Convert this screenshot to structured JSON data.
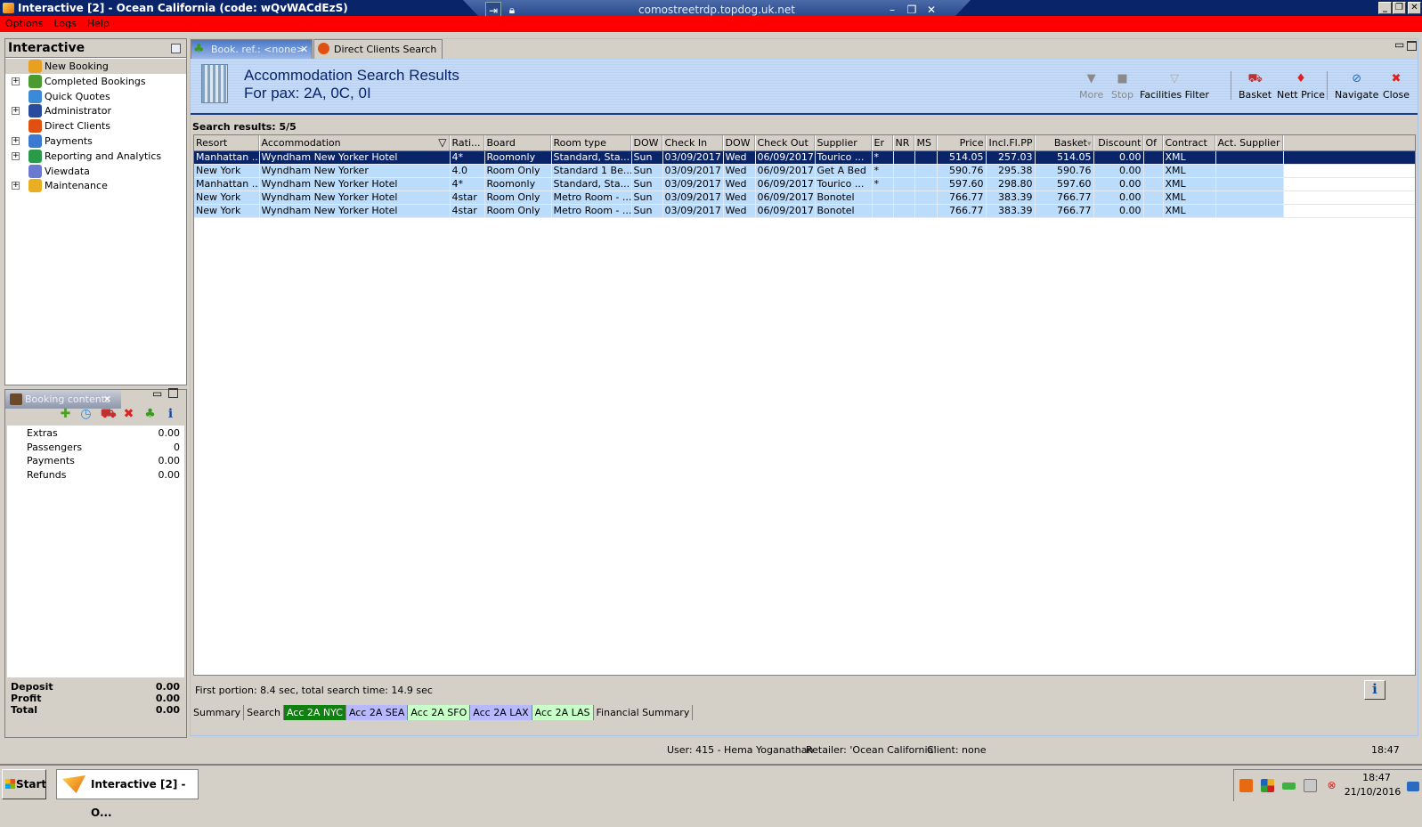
{
  "window": {
    "title": "Interactive [2] - Ocean California (code: wQvWACdEzS)",
    "rdp_host": "comostreetrdp.topdog.uk.net"
  },
  "menu": [
    "Options",
    "Logs",
    "Help"
  ],
  "sidebar": {
    "title": "Interactive",
    "items": [
      {
        "label": "New Booking",
        "expandable": false,
        "icon": "palm-tree-icon",
        "color": "#e8a020"
      },
      {
        "label": "Completed Bookings",
        "expandable": true,
        "icon": "palm-money-icon",
        "color": "#4a9a30"
      },
      {
        "label": "Quick Quotes",
        "expandable": false,
        "icon": "clock-icon",
        "color": "#3a8ad8"
      },
      {
        "label": "Administrator",
        "expandable": true,
        "icon": "runner-icon",
        "color": "#2a4aa0"
      },
      {
        "label": "Direct Clients",
        "expandable": false,
        "icon": "client-icon",
        "color": "#e05010"
      },
      {
        "label": "Payments",
        "expandable": true,
        "icon": "payments-icon",
        "color": "#3a7ad0"
      },
      {
        "label": "Reporting and Analytics",
        "expandable": true,
        "icon": "report-icon",
        "color": "#2a9a4a"
      },
      {
        "label": "Viewdata",
        "expandable": false,
        "icon": "globe-icon",
        "color": "#6a7ad0"
      },
      {
        "label": "Maintenance",
        "expandable": true,
        "icon": "maintenance-icon",
        "color": "#e8b020"
      }
    ]
  },
  "booking": {
    "tab": "Booking contents",
    "rows": [
      {
        "label": "Extras",
        "value": "0.00"
      },
      {
        "label": "Passengers",
        "value": "0"
      },
      {
        "label": "Payments",
        "value": "0.00"
      },
      {
        "label": "Refunds",
        "value": "0.00"
      }
    ],
    "totals": [
      {
        "label": "Deposit",
        "value": "0.00"
      },
      {
        "label": "Profit",
        "value": "0.00"
      },
      {
        "label": "Total",
        "value": "0.00"
      }
    ]
  },
  "tabs": [
    {
      "label": "Book. ref.: <none>",
      "active": true
    },
    {
      "label": "Direct Clients Search",
      "active": false
    }
  ],
  "header": {
    "title": "Accommodation Search Results",
    "subtitle": "For pax: 2A, 0C, 0I"
  },
  "toolbar": [
    {
      "label": "More",
      "icon": "more-icon",
      "disabled": true
    },
    {
      "label": "Stop",
      "icon": "stop-icon",
      "disabled": true
    },
    {
      "label": "Facilities Filter",
      "icon": "filter-icon",
      "disabled": false
    },
    {
      "label": "Basket",
      "icon": "basket-icon",
      "disabled": false
    },
    {
      "label": "Nett Price",
      "icon": "nett-price-icon",
      "disabled": false
    },
    {
      "label": "Navigate",
      "icon": "navigate-icon",
      "disabled": false
    },
    {
      "label": "Close",
      "icon": "close-icon",
      "disabled": false
    }
  ],
  "results": {
    "summary": "Search results: 5/5",
    "columns": [
      "Resort",
      "Accommodation",
      "Rati...",
      "Board",
      "Room type",
      "DOW",
      "Check In",
      "DOW",
      "Check Out",
      "Supplier",
      "Er",
      "NR",
      "MS",
      "Price",
      "Incl.Fl.PP",
      "Basket",
      "Discount",
      "Of",
      "Contract",
      "Act. Supplier"
    ],
    "rows": [
      [
        "Manhattan ...",
        "Wyndham New Yorker Hotel",
        "4*",
        "Roomonly",
        "Standard, Sta...",
        "Sun",
        "03/09/2017",
        "Wed",
        "06/09/2017",
        "Tourico ...",
        "*",
        "",
        "",
        "514.05",
        "257.03",
        "514.05",
        "0.00",
        "",
        "XML",
        ""
      ],
      [
        "New York",
        "Wyndham New Yorker",
        "4.0",
        "Room Only",
        "Standard 1 Be...",
        "Sun",
        "03/09/2017",
        "Wed",
        "06/09/2017",
        "Get A Bed",
        "*",
        "",
        "",
        "590.76",
        "295.38",
        "590.76",
        "0.00",
        "",
        "XML",
        ""
      ],
      [
        "Manhattan ...",
        "Wyndham New Yorker Hotel",
        "4*",
        "Roomonly",
        "Standard, Sta...",
        "Sun",
        "03/09/2017",
        "Wed",
        "06/09/2017",
        "Tourico ...",
        "*",
        "",
        "",
        "597.60",
        "298.80",
        "597.60",
        "0.00",
        "",
        "XML",
        ""
      ],
      [
        "New York",
        "Wyndham New Yorker Hotel",
        "4star",
        "Room Only",
        "Metro Room - ...",
        "Sun",
        "03/09/2017",
        "Wed",
        "06/09/2017",
        "Bonotel",
        "",
        "",
        "",
        "766.77",
        "383.39",
        "766.77",
        "0.00",
        "",
        "XML",
        ""
      ],
      [
        "New York",
        "Wyndham New Yorker Hotel",
        "4star",
        "Room Only",
        "Metro Room - ...",
        "Sun",
        "03/09/2017",
        "Wed",
        "06/09/2017",
        "Bonotel",
        "",
        "",
        "",
        "766.77",
        "383.39",
        "766.77",
        "0.00",
        "",
        "XML",
        ""
      ]
    ]
  },
  "status_text": "First portion: 8.4 sec, total search time: 14.9 sec",
  "bottom_tabs": [
    {
      "label": "Summary",
      "color": "#d4d0c8",
      "fg": "#000000"
    },
    {
      "label": "Search",
      "color": "#d4d0c8",
      "fg": "#000000"
    },
    {
      "label": "Acc 2A NYC",
      "color": "#108010",
      "fg": "#ffffff"
    },
    {
      "label": "Acc 2A SEA",
      "color": "#b8b8ff",
      "fg": "#000000"
    },
    {
      "label": "Acc 2A SFO",
      "color": "#c8ffc8",
      "fg": "#000000"
    },
    {
      "label": "Acc 2A LAX",
      "color": "#b8b8ff",
      "fg": "#000000"
    },
    {
      "label": "Acc 2A LAS",
      "color": "#c8ffc8",
      "fg": "#000000"
    },
    {
      "label": "Financial Summary",
      "color": "#d4d0c8",
      "fg": "#000000"
    }
  ],
  "statusbar": {
    "user": "User: 415 - Hema Yoganathan",
    "retailer": "Retailer: 'Ocean California'",
    "client": "Client: none",
    "time": "18:47 GMT"
  },
  "taskbar": {
    "start": "Start",
    "app": "Interactive [2] - O...",
    "clock_time": "18:47",
    "clock_date": "21/10/2016"
  }
}
